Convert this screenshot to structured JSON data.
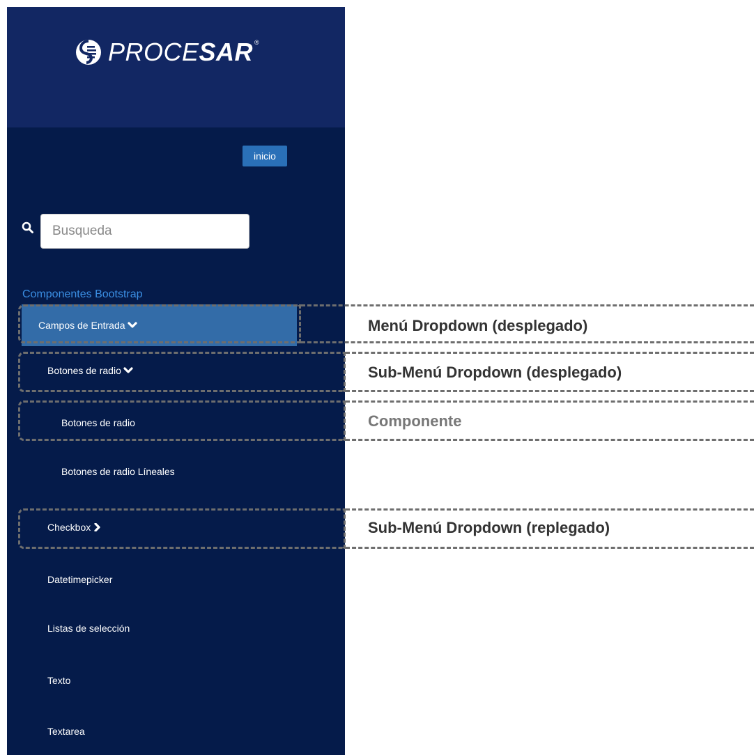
{
  "brand": {
    "logo_light": "PROCE",
    "logo_bold": "SAR",
    "registered": "®"
  },
  "header": {
    "home_button": "inicio"
  },
  "search": {
    "placeholder": "Busqueda",
    "value": ""
  },
  "sidebar": {
    "section_title": "Componentes Bootstrap",
    "menu": {
      "campos_de_entrada": "Campos de Entrada",
      "botones_de_radio": "Botones de radio",
      "botones_de_radio_child": "Botones de radio",
      "botones_de_radio_lineales": "Botones de radio Líneales",
      "checkbox": "Checkbox",
      "datetimepicker": "Datetimepicker",
      "listas_de_seleccion": "Listas de selección",
      "texto": "Texto",
      "textarea": "Textarea"
    }
  },
  "annotations": {
    "dropdown_open": "Menú Dropdown (desplegado)",
    "submenu_open": "Sub-Menú Dropdown (desplegado)",
    "component": "Componente",
    "submenu_closed": "Sub-Menú Dropdown (replegado)"
  },
  "colors": {
    "sidebar_bg": "#051b4a",
    "logo_bg": "#122763",
    "active_item_bg": "#336ca8",
    "home_button_bg": "#2a70b8",
    "section_title": "#3b8fe4",
    "annotation_dash": "#6e6e6e"
  }
}
